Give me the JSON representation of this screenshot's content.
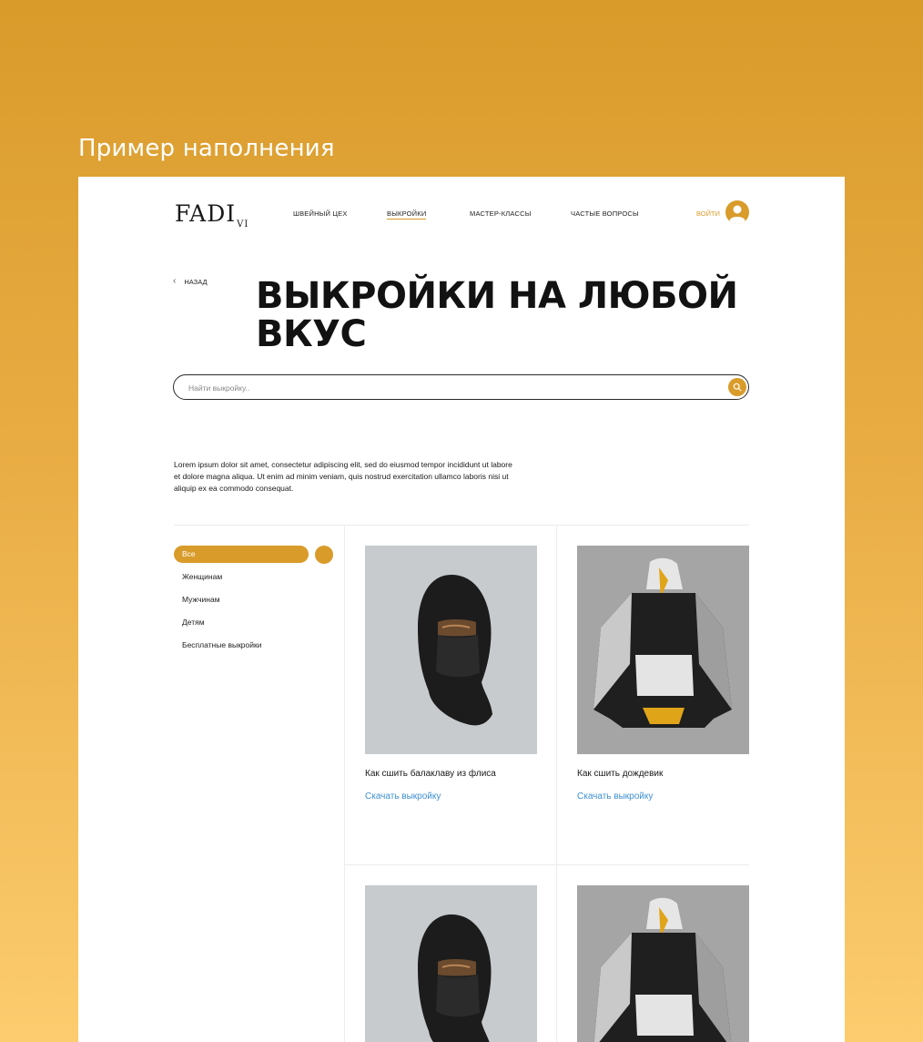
{
  "showcase": {
    "title": "Пример наполнения"
  },
  "header": {
    "logo": "FADI",
    "logo_sub": "VI",
    "nav": [
      {
        "label": "ШВЕЙНЫЙ ЦЕХ"
      },
      {
        "label": "ВЫКРОЙКИ",
        "active": true
      },
      {
        "label": "МАСТЕР-КЛАССЫ"
      },
      {
        "label": "ЧАСТЫЕ ВОПРОСЫ"
      }
    ],
    "login": "ВОЙТИ"
  },
  "back_label": "НАЗАД",
  "hero_title": "ВЫКРОЙКИ НА ЛЮБОЙ ВКУС",
  "search": {
    "placeholder": "Найти выкройку.."
  },
  "description": "Lorem ipsum dolor sit amet, consectetur adipiscing elit, sed do eiusmod tempor incididunt ut labore et dolore magna aliqua. Ut enim ad minim veniam, quis nostrud exercitation ullamco laboris nisi ut aliquip ex ea commodo consequat.",
  "filters": [
    {
      "label": "Все",
      "active": true
    },
    {
      "label": "Женщинам"
    },
    {
      "label": "Мужчинам"
    },
    {
      "label": "Детям"
    },
    {
      "label": "Бесплатные выкройки"
    }
  ],
  "cards": [
    {
      "title": "Как сшить балаклаву из флиса",
      "link": "Скачать выкройку",
      "image": "balaclava-photo"
    },
    {
      "title": "Как сшить дождевик",
      "link": "Скачать выкройку",
      "image": "raincoat-photo"
    },
    {
      "title": "",
      "link": "",
      "image": "balaclava-photo"
    },
    {
      "title": "",
      "link": "",
      "image": "raincoat-photo"
    }
  ],
  "colors": {
    "accent": "#d99b2a",
    "link": "#3d8fd4",
    "text": "#121212"
  }
}
